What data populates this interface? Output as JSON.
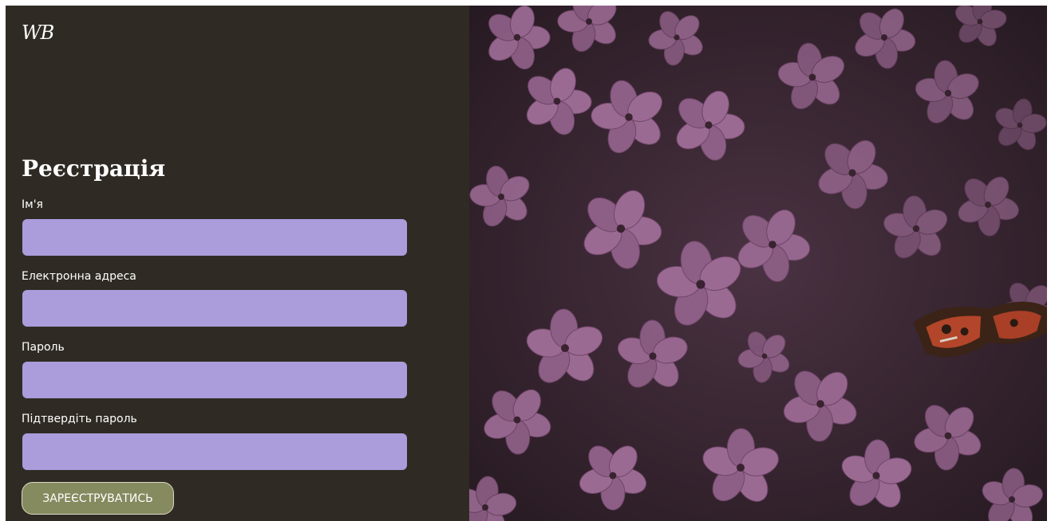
{
  "brand": {
    "logo_text": "WB"
  },
  "form": {
    "title": "Реєстрація",
    "fields": [
      {
        "label": "Ім'я",
        "value": "",
        "placeholder": ""
      },
      {
        "label": "Електронна адреса",
        "value": "",
        "placeholder": ""
      },
      {
        "label": "Пароль",
        "value": "",
        "placeholder": ""
      },
      {
        "label": "Підтвердіть пароль",
        "value": "",
        "placeholder": ""
      }
    ],
    "submit_label": "ЗАРЕЄСТРУВАТИСЬ"
  },
  "hero_image": {
    "subject": "pink-phlox-flowers-with-butterfly"
  },
  "colors": {
    "panel_bg": "#2f2b24",
    "input_bg": "#ab9cdb",
    "button_bg": "#858b5f",
    "text": "#ffffff"
  }
}
